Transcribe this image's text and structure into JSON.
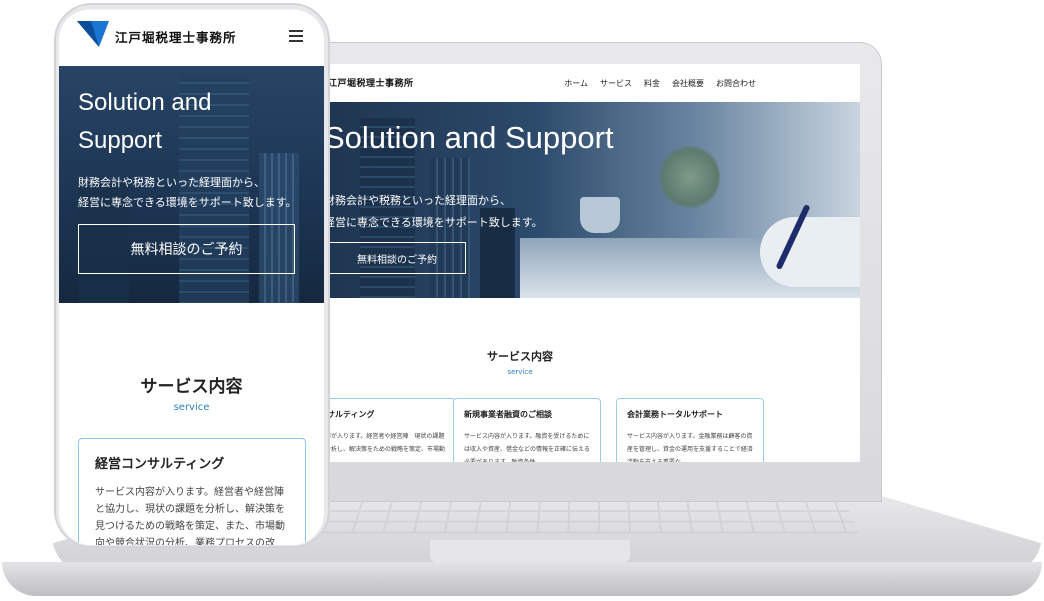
{
  "brand": {
    "name": "江戸堀税理士事務所",
    "accent": "#2b7fc4",
    "logo_color": "#1a76d2"
  },
  "desktop": {
    "nav": [
      "ホーム",
      "サービス",
      "料金",
      "会社概要",
      "お問合わせ"
    ],
    "hero": {
      "title": "Solution and Support",
      "subtitle_line1": "財務会計や税務といった経理面から、",
      "subtitle_line2": "経営に専念できる環境をサポート致します。",
      "cta": "無料相談のご予約"
    },
    "services": {
      "title": "サービス内容",
      "subtitle": "service",
      "cards": [
        {
          "title": "ンサルティング",
          "body": "内容が入ります。経営者や経営陣　現状の課題を分析し、解決策をための戦略を策定、市場動"
        },
        {
          "title": "新規事業者融資のご相談",
          "body": "サービス内容が入ります。融資を受けるためには収入や資産、借金などの情報を正確に伝える必要があります。融資条件"
        },
        {
          "title": "会計業務トータルサポート",
          "body": "サービス内容が入ります。金融業務は顧客の資産を管理し、資金の運用を支援することで経済活動を支える重要な"
        }
      ]
    }
  },
  "mobile": {
    "hero": {
      "title_line1": "Solution and",
      "title_line2": "Support",
      "subtitle_line1": "財務会計や税務といった経理面から、",
      "subtitle_line2": "経営に専念できる環境をサポート致します。",
      "cta": "無料相談のご予約"
    },
    "services": {
      "title": "サービス内容",
      "subtitle": "service",
      "card": {
        "title": "経営コンサルティング",
        "body": "サービス内容が入ります。経営者や経営陣と協力し、現状の課題を分析し、解決策を見つけるための戦略を策定、また、市場動向や競合状況の分析、業務プロセスの改"
      }
    }
  }
}
